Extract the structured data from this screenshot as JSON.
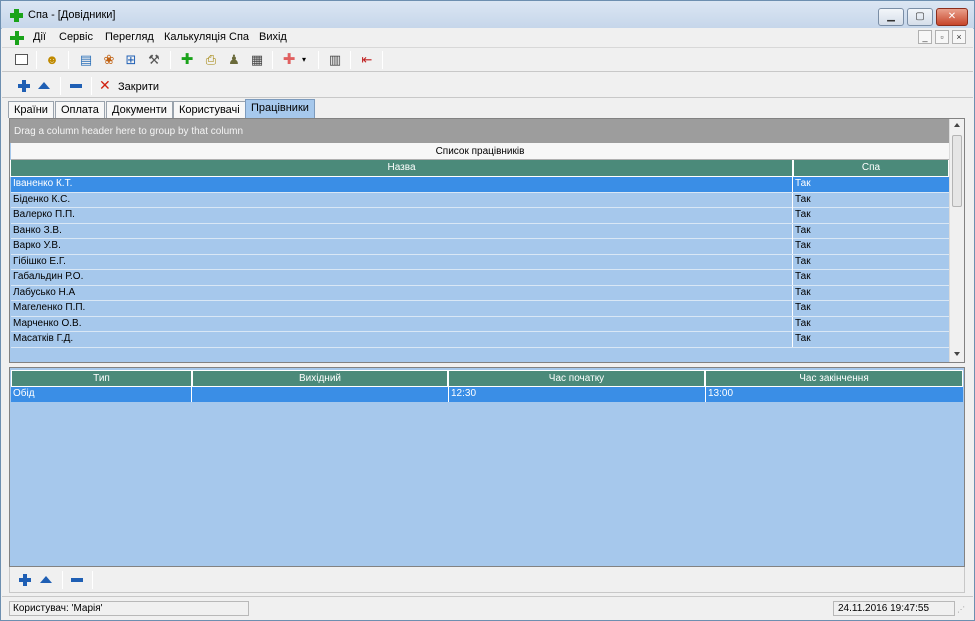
{
  "window": {
    "title": "Спа - [Довідники]"
  },
  "menu": {
    "items": [
      "Дії",
      "Сервіс",
      "Перегляд",
      "Калькуляція Спа",
      "Вихід"
    ]
  },
  "actionbar": {
    "close_label": "Закрити"
  },
  "tabs": [
    "Країни",
    "Оплата",
    "Документи",
    "Користувачі",
    "Працівники"
  ],
  "active_tab": "Працівники",
  "upper_grid": {
    "group_hint": "Drag a column header here to group by that column",
    "band_title": "Список працівників",
    "columns": [
      "Назва",
      "Спа"
    ],
    "rows": [
      {
        "name": "Іваненко К.Т.",
        "spa": "Так"
      },
      {
        "name": "Біденко К.С.",
        "spa": "Так"
      },
      {
        "name": "Валерко П.П.",
        "spa": "Так"
      },
      {
        "name": "Ванко З.В.",
        "spa": "Так"
      },
      {
        "name": "Варко У.В.",
        "spa": "Так"
      },
      {
        "name": "Гібішко Е.Г.",
        "spa": "Так"
      },
      {
        "name": "Габальдин Р.О.",
        "spa": "Так"
      },
      {
        "name": "Лабусько Н.А",
        "spa": "Так"
      },
      {
        "name": "Магеленко П.П.",
        "spa": "Так"
      },
      {
        "name": "Марченко О.В.",
        "spa": "Так"
      },
      {
        "name": "Масатків Г.Д.",
        "spa": "Так"
      }
    ]
  },
  "lower_grid": {
    "columns": [
      "Тип",
      "Вихідний",
      "Час початку",
      "Час закінчення"
    ],
    "rows": [
      {
        "type": "Обід",
        "dayoff": "",
        "start": "12:30",
        "end": "13:00"
      }
    ]
  },
  "status": {
    "user": "Користувач:  'Марія'",
    "datetime": "24.11.2016 19:47:55"
  }
}
